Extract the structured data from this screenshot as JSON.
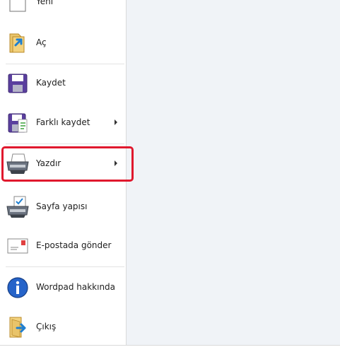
{
  "menu": {
    "items": [
      {
        "id": "new",
        "label": "Yeni",
        "icon": "new-document-icon",
        "has_submenu": false
      },
      {
        "id": "open",
        "label": "Aç",
        "icon": "open-folder-icon",
        "has_submenu": false
      },
      {
        "id": "save",
        "label": "Kaydet",
        "icon": "save-floppy-icon",
        "has_submenu": false
      },
      {
        "id": "save_as",
        "label": "Farklı kaydet",
        "icon": "save-as-icon",
        "has_submenu": true
      },
      {
        "id": "print",
        "label": "Yazdır",
        "icon": "printer-icon",
        "has_submenu": true
      },
      {
        "id": "page_setup",
        "label": "Sayfa yapısı",
        "icon": "page-setup-icon",
        "has_submenu": false
      },
      {
        "id": "email",
        "label": "E-postada gönder",
        "icon": "email-icon",
        "has_submenu": false
      },
      {
        "id": "about",
        "label": "Wordpad hakkında",
        "icon": "info-icon",
        "has_submenu": false
      },
      {
        "id": "exit",
        "label": "Çıkış",
        "icon": "exit-icon",
        "has_submenu": false
      }
    ]
  },
  "highlight": {
    "target": "print",
    "color": "#e0182d"
  },
  "colors": {
    "content_pane": "#f0f3f7",
    "divider": "#dadada"
  }
}
